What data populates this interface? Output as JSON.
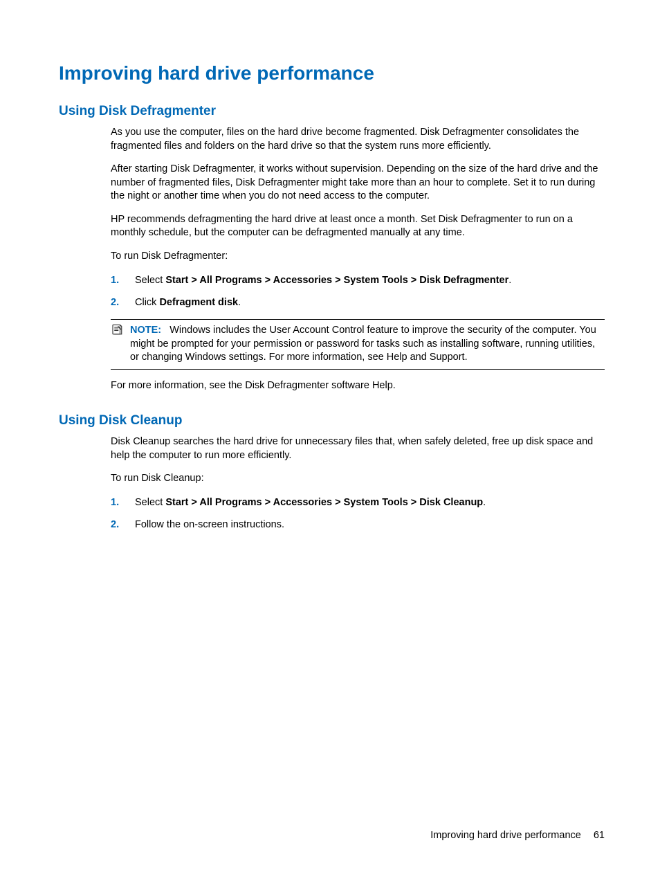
{
  "heading": "Improving hard drive performance",
  "section1": {
    "title": "Using Disk Defragmenter",
    "p1": "As you use the computer, files on the hard drive become fragmented. Disk Defragmenter consolidates the fragmented files and folders on the hard drive so that the system runs more efficiently.",
    "p2": "After starting Disk Defragmenter, it works without supervision. Depending on the size of the hard drive and the number of fragmented files, Disk Defragmenter might take more than an hour to complete. Set it to run during the night or another time when you do not need access to the computer.",
    "p3": "HP recommends defragmenting the hard drive at least once a month. Set Disk Defragmenter to run on a monthly schedule, but the computer can be defragmented manually at any time.",
    "p4": "To run Disk Defragmenter:",
    "step1_num": "1.",
    "step1_pre": "Select ",
    "step1_bold": "Start > All Programs > Accessories > System Tools > Disk Defragmenter",
    "step1_post": ".",
    "step2_num": "2.",
    "step2_pre": "Click ",
    "step2_bold": "Defragment disk",
    "step2_post": ".",
    "note_label": "NOTE:",
    "note_body": "Windows includes the User Account Control feature to improve the security of the computer. You might be prompted for your permission or password for tasks such as installing software, running utilities, or changing Windows settings. For more information, see Help and Support.",
    "p5": "For more information, see the Disk Defragmenter software Help."
  },
  "section2": {
    "title": "Using Disk Cleanup",
    "p1": "Disk Cleanup searches the hard drive for unnecessary files that, when safely deleted, free up disk space and help the computer to run more efficiently.",
    "p2": "To run Disk Cleanup:",
    "step1_num": "1.",
    "step1_pre": "Select ",
    "step1_bold": "Start > All Programs > Accessories > System Tools > Disk Cleanup",
    "step1_post": ".",
    "step2_num": "2.",
    "step2_text": "Follow the on-screen instructions."
  },
  "footer": {
    "title": "Improving hard drive performance",
    "page": "61"
  }
}
